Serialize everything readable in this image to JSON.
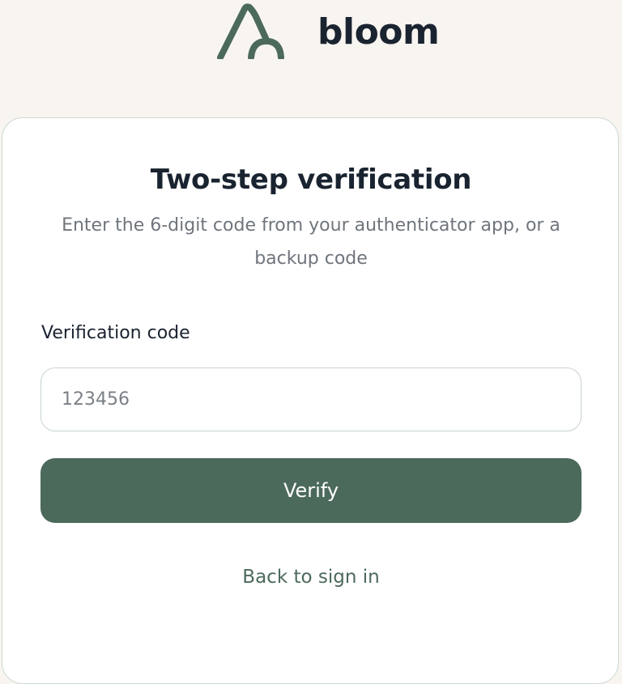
{
  "brand": {
    "name": "bloom",
    "logo_icon": "bloom-leaf-logo",
    "logo_color": "#4c6a5b"
  },
  "card": {
    "title": "Two-step verification",
    "subtitle": "Enter the 6-digit code from your authenticator app, or a backup code",
    "field": {
      "label": "Verification code",
      "value": "",
      "placeholder": "123456"
    },
    "verify_label": "Verify",
    "back_link": "Back to sign in"
  },
  "colors": {
    "background": "#f8f5f0",
    "accent": "#4c6a5b",
    "text": "#1a2330",
    "muted": "#6f757c"
  }
}
